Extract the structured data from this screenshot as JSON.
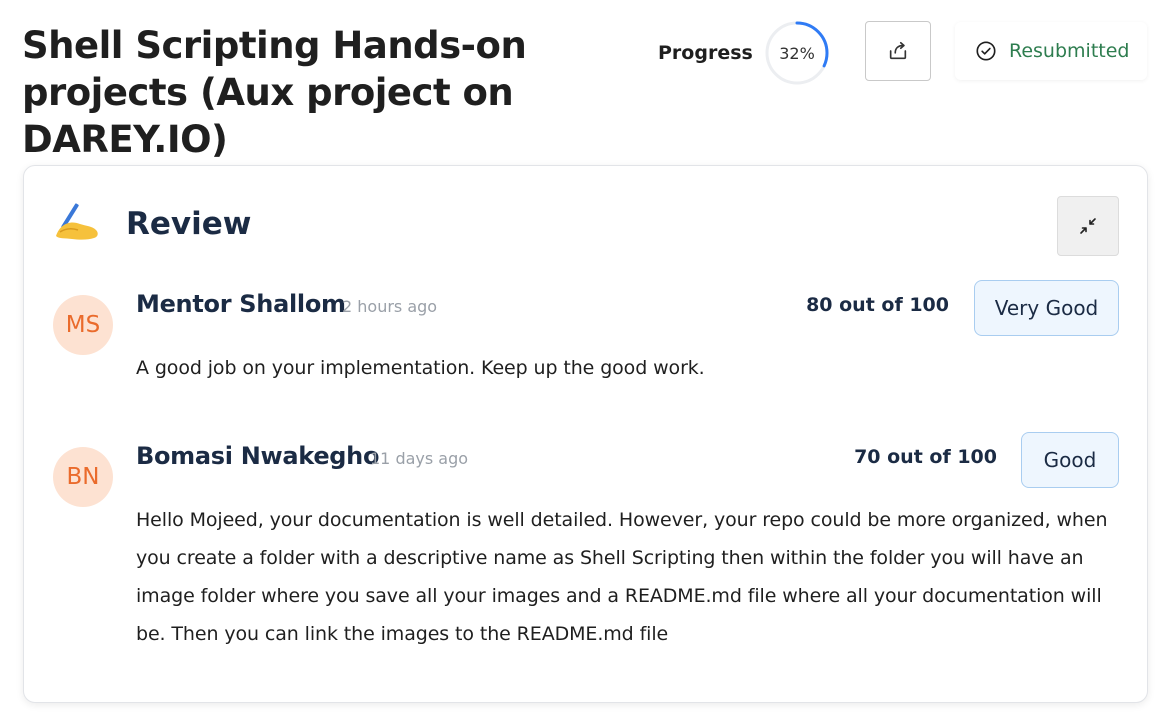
{
  "header": {
    "title": "Shell Scripting Hands-on projects (Aux project on DAREY.IO)",
    "progress_label": "Progress",
    "progress_value": "32%",
    "progress_fraction": 0.32,
    "status_text": "Resubmitted",
    "status_color": "#2e7d4f",
    "accent_color": "#2f7bf5",
    "share_icon": "share-icon",
    "status_icon": "check-circle-icon"
  },
  "review_panel": {
    "title": "Review",
    "emoji": "writing-hand-icon",
    "collapse_icon": "collapse-icon"
  },
  "reviews": [
    {
      "initials": "MS",
      "name": "Mentor Shallom",
      "time": "2 hours ago",
      "score": "80 out of 100",
      "rating": "Very Good",
      "comment": "A good job on your implementation. Keep up the good work."
    },
    {
      "initials": "BN",
      "name": "Bomasi Nwakegho",
      "time": "11 days ago",
      "score": "70 out of 100",
      "rating": "Good",
      "comment": "Hello Mojeed, your documentation is well detailed. However, your repo could be more organized, when you create a folder with a descriptive name as Shell Scripting then within the folder you will have an image folder where you save all your images and a README.md file where all your documentation will be. Then you can link the images to the README.md file"
    }
  ]
}
